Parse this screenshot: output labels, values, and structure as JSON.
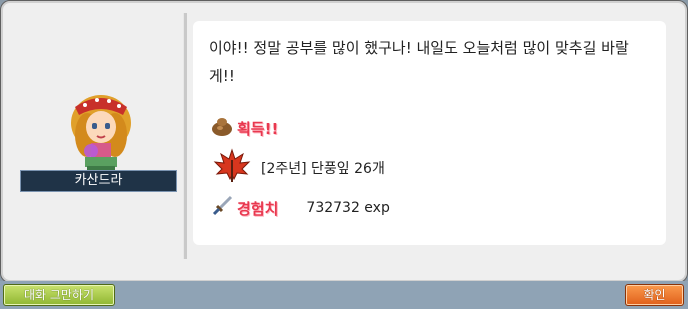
{
  "npc": {
    "name": "카산드라"
  },
  "dialog": {
    "message": "이야!! 정말 공부를 많이 했구나! 내일도 오늘처럼 많이 맞추길 바랄게!!",
    "reward_title": "획득!!",
    "item": {
      "name": "[2주년] 단풍잎 26개",
      "icon": "maple-leaf-icon"
    },
    "exp": {
      "label": "경험치",
      "value": "732732 exp",
      "icon": "sword-icon"
    }
  },
  "buttons": {
    "end_chat": "대화 그만하기",
    "ok": "확인"
  },
  "colors": {
    "accent_red": "#e8384f",
    "ok_orange": "#f07a30",
    "end_green": "#a8c84a"
  }
}
